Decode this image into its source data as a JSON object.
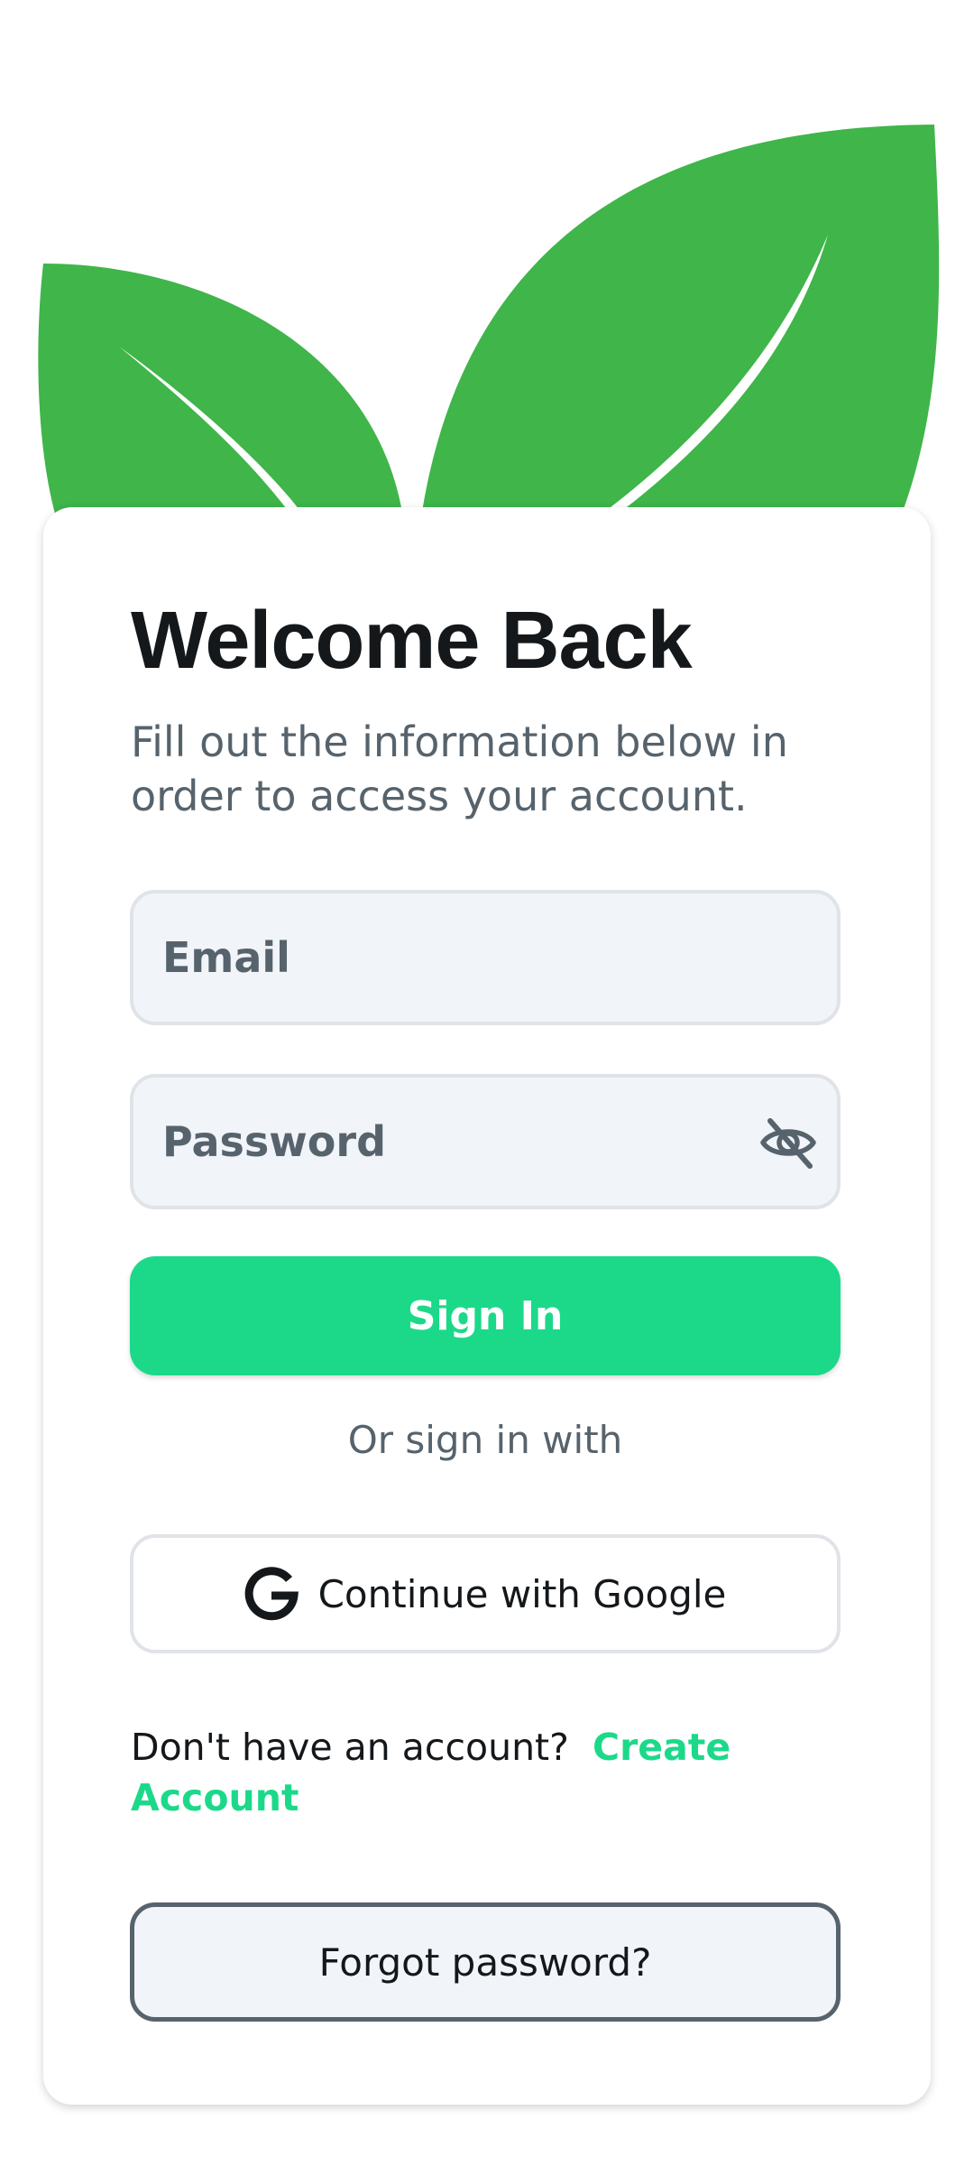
{
  "header": {
    "logo_icon": "leaf-icon"
  },
  "login": {
    "title": "Welcome Back",
    "subtitle": "Fill out the information below in order to access your account.",
    "email": {
      "placeholder": "Email",
      "value": ""
    },
    "password": {
      "placeholder": "Password",
      "value": "",
      "visibility_icon": "eye-off-icon"
    },
    "sign_in_label": "Sign In",
    "divider_text": "Or sign in with",
    "google": {
      "icon": "google-icon",
      "label": "Continue with Google"
    },
    "account_prompt": "Don't have an account?",
    "create_account_label": "Create Account",
    "forgot_password_label": "Forgot password?"
  },
  "colors": {
    "brand_green": "#3fb54a",
    "accent": "#1cd98a",
    "text_primary": "#14181b",
    "text_secondary": "#57636c",
    "field_bg": "#f1f4f8",
    "field_border": "#e0e3e7"
  }
}
